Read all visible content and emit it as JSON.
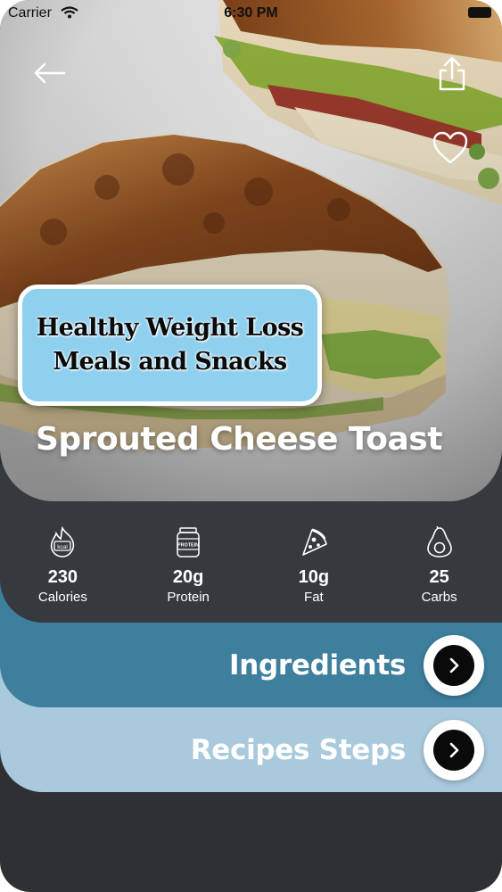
{
  "status_bar": {
    "carrier": "Carrier",
    "time": "6:30 PM"
  },
  "hero": {
    "badge_line1": "Healthy Weight Loss",
    "badge_line2": "Meals and Snacks",
    "title": "Sprouted Cheese Toast"
  },
  "nutrition": [
    {
      "value": "230",
      "label": "Calories",
      "icon": "kcal-flame-icon",
      "icon_text": "kcal"
    },
    {
      "value": "20g",
      "label": "Protein",
      "icon": "protein-jar-icon",
      "icon_text": "PROTEIN"
    },
    {
      "value": "10g",
      "label": "Fat",
      "icon": "pizza-slice-icon"
    },
    {
      "value": "25",
      "label": "Carbs",
      "icon": "avocado-icon"
    }
  ],
  "sections": {
    "ingredients": "Ingredients",
    "steps": "Recipes Steps"
  },
  "colors": {
    "nutrition_card": "#363a3f",
    "ingredients_card": "#3d7f9d",
    "steps_card": "#a9c9dc",
    "background": "#2f3033",
    "badge": "#8fd0ee"
  }
}
